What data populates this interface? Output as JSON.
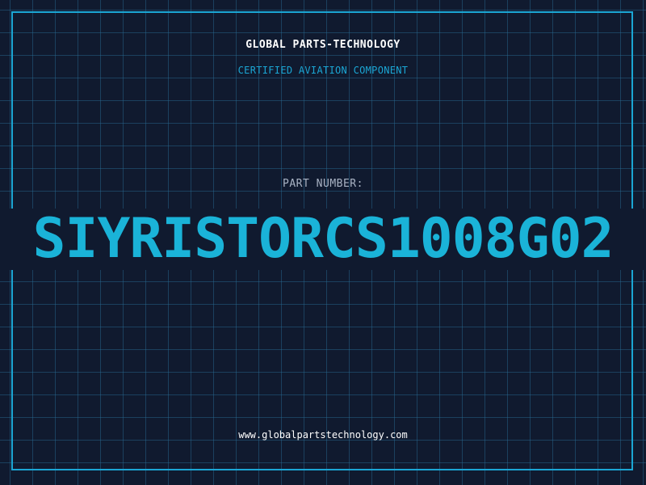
{
  "header": {
    "company": "GLOBAL PARTS-TECHNOLOGY",
    "subtitle": "CERTIFIED AVIATION COMPONENT"
  },
  "part": {
    "label": "PART NUMBER:",
    "number": "SIYRISTORCS1008G02"
  },
  "footer": {
    "website": "www.globalpartstechnology.com"
  },
  "colors": {
    "background": "#101a2f",
    "accent": "#1ba6d4",
    "grid": "#286e96"
  }
}
